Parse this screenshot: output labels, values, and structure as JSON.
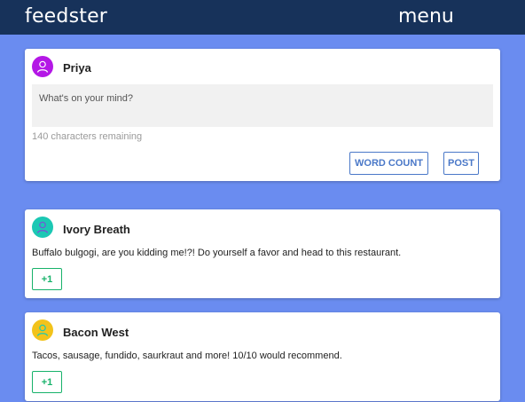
{
  "header": {
    "brand": "feedster",
    "menu_label": "menu",
    "background": "#17325a"
  },
  "page": {
    "background": "#6a8cf0"
  },
  "composer": {
    "username": "Priya",
    "avatar_color": "#b417e6",
    "avatar_icon": "user-icon",
    "placeholder": "What's on your mind?",
    "value": "",
    "remaining_text": "140 characters remaining",
    "word_count_label": "WORD COUNT",
    "post_label": "POST"
  },
  "feed": {
    "posts": [
      {
        "username": "Ivory Breath",
        "avatar_color": "#1cc8b4",
        "avatar_icon": "user-icon",
        "text": "Buffalo bulgogi, are you kidding me!?! Do yourself a favor and head to this restaurant.",
        "plus_label": "+1"
      },
      {
        "username": "Bacon West",
        "avatar_color": "#f2c31b",
        "avatar_icon": "user-icon",
        "text": "Tacos, sausage, fundido, saurkraut and more! 10/10 would recommend.",
        "plus_label": "+1"
      }
    ]
  }
}
